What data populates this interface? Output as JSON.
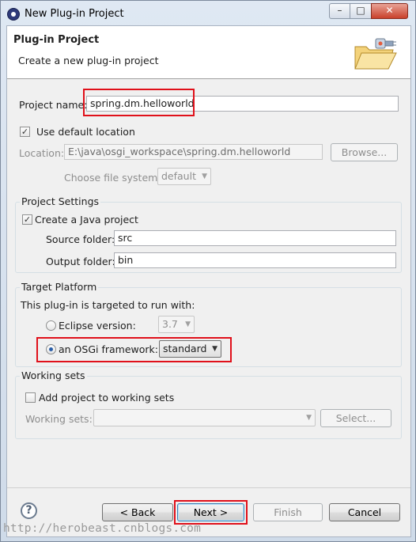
{
  "window": {
    "title": "New Plug-in Project",
    "minimize_icon": "minimize-icon",
    "maximize_icon": "maximize-icon",
    "close_icon": "close-icon",
    "minimize_glyph": "–",
    "maximize_glyph": "□",
    "close_glyph": "✕"
  },
  "header": {
    "title": "Plug-in Project",
    "description": "Create a new plug-in project"
  },
  "project": {
    "name_label": "Project name:",
    "name_value": "spring.dm.helloworld",
    "use_default_label": "Use default location",
    "use_default_checked": true,
    "location_label": "Location:",
    "location_value": "E:\\java\\osgi_workspace\\spring.dm.helloworld",
    "browse_label": "Browse...",
    "file_system_label": "Choose file system:",
    "file_system_value": "default"
  },
  "project_settings": {
    "title": "Project Settings",
    "java_project_label": "Create a Java project",
    "java_project_checked": true,
    "source_label": "Source folder:",
    "source_value": "src",
    "output_label": "Output folder:",
    "output_value": "bin"
  },
  "target_platform": {
    "title": "Target Platform",
    "intro": "This plug-in is targeted to run with:",
    "eclipse_label": "Eclipse version:",
    "eclipse_value": "3.7",
    "osgi_label": "an OSGi framework:",
    "osgi_value": "standard",
    "selected": "osgi"
  },
  "working_sets": {
    "title": "Working sets",
    "add_label": "Add project to working sets",
    "add_checked": false,
    "sets_label": "Working sets:",
    "select_label": "Select..."
  },
  "footer": {
    "back_label": "< Back",
    "next_label": "Next >",
    "finish_label": "Finish",
    "cancel_label": "Cancel",
    "help_glyph": "?"
  },
  "watermark": "http://herobeast.cnblogs.com",
  "colors": {
    "highlight": "#e0101a",
    "accent": "#3c7fb1"
  }
}
